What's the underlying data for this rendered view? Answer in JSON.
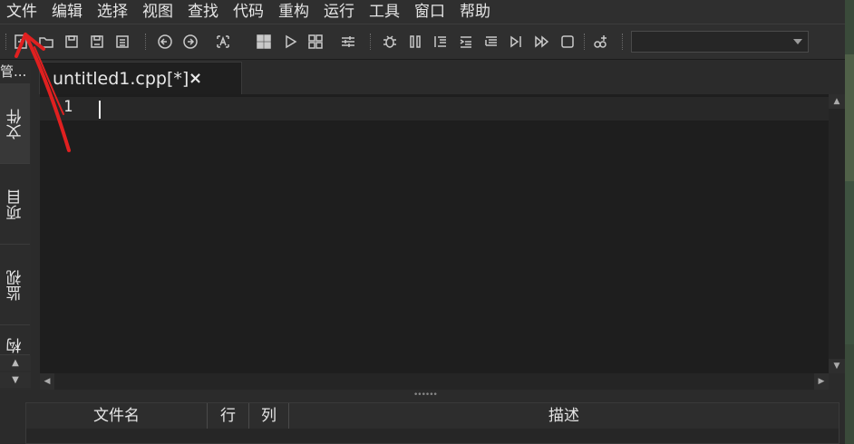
{
  "menubar": {
    "items": [
      "文件",
      "编辑",
      "选择",
      "视图",
      "查找",
      "代码",
      "重构",
      "运行",
      "工具",
      "窗口",
      "帮助"
    ]
  },
  "toolbar": {
    "icons": [
      "new-file-icon",
      "open-file-icon",
      "save-icon",
      "save-as-icon",
      "save-all-icon",
      "back-icon",
      "forward-icon",
      "font-case-icon",
      "compile-icon",
      "run-icon",
      "compile-run-icon",
      "options-icon",
      "debug-icon",
      "pause-icon",
      "step-into-icon",
      "step-over-icon",
      "step-out-icon",
      "run-to-cursor-icon",
      "continue-icon",
      "stop-icon",
      "add-watch-icon"
    ],
    "target_value": ""
  },
  "sidepanel": {
    "title": "管...",
    "tabs": [
      "文件",
      "项目",
      "监视",
      "构"
    ]
  },
  "editor": {
    "tab_label": "untitled1.cpp[*]",
    "tab_close": "×",
    "line_number": "1"
  },
  "bottompanel": {
    "headers": [
      "文件名",
      "行",
      "列",
      "描述"
    ]
  },
  "colors": {
    "background": "#2b2b2b",
    "editor": "#1e1e1e",
    "annotation_arrow": "#e02020"
  }
}
